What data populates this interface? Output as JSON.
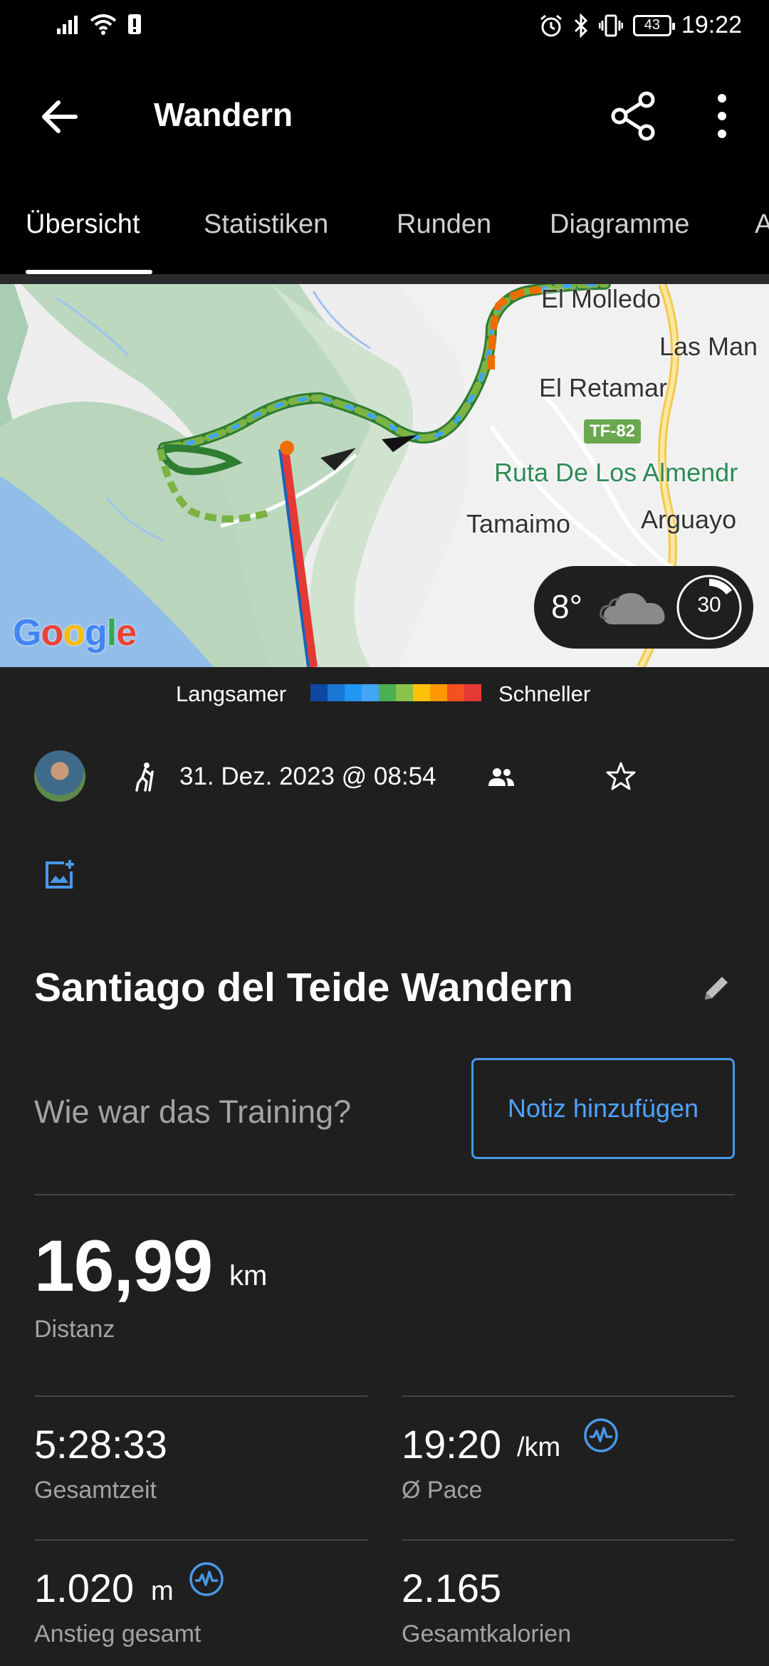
{
  "status_bar": {
    "time": "19:22",
    "battery": "43",
    "icons": [
      "signal-icon",
      "wifi-icon",
      "sim-icon",
      "alarm-icon",
      "bluetooth-icon",
      "vibrate-icon",
      "battery-icon"
    ]
  },
  "app_bar": {
    "title": "Wandern",
    "icons": [
      "back-arrow-icon",
      "share-icon",
      "more-vert-icon"
    ]
  },
  "tabs": [
    {
      "label": "Übersicht",
      "active": true
    },
    {
      "label": "Statistiken",
      "active": false
    },
    {
      "label": "Runden",
      "active": false
    },
    {
      "label": "Diagramme",
      "active": false
    },
    {
      "label": "A",
      "active": false
    }
  ],
  "map": {
    "labels": {
      "lomo": "El Molledo",
      "manchas": "Las Man",
      "retamar": "El Retamar",
      "road": "TF-82",
      "ruta": "Ruta De Los Almendr",
      "tamaimo": "Tamaimo",
      "arguayo": "Arguayo"
    },
    "provider": "Google",
    "weather": {
      "temperature": "8°",
      "condition_icon": "cloud-icon",
      "gauge_value": "30"
    }
  },
  "legend": {
    "slow_label": "Langsamer",
    "fast_label": "Schneller",
    "colors": [
      "#0d47a1",
      "#1976d2",
      "#2196f3",
      "#42a5f5",
      "#4caf50",
      "#8bc34a",
      "#ffc107",
      "#ff9800",
      "#f4511e",
      "#e53935"
    ]
  },
  "activity": {
    "date": "31. Dez. 2023 @ 08:54",
    "title": "Santiago del Teide Wandern",
    "note_prompt": "Wie war das Training?",
    "note_button": "Notiz hinzufügen"
  },
  "stats": {
    "distance": {
      "value": "16,99",
      "unit": "km",
      "label": "Distanz"
    },
    "total_time": {
      "value": "5:28:33",
      "label": "Gesamtzeit"
    },
    "pace": {
      "value": "19:20",
      "unit": "/km",
      "label": "Ø Pace"
    },
    "ascent": {
      "value": "1.020",
      "unit": "m",
      "label": "Anstieg gesamt"
    },
    "calories": {
      "value": "2.165",
      "label": "Gesamtkalorien"
    }
  },
  "colors": {
    "accent": "#4a98e8",
    "background": "#1f1f1f",
    "bar": "#000000"
  }
}
